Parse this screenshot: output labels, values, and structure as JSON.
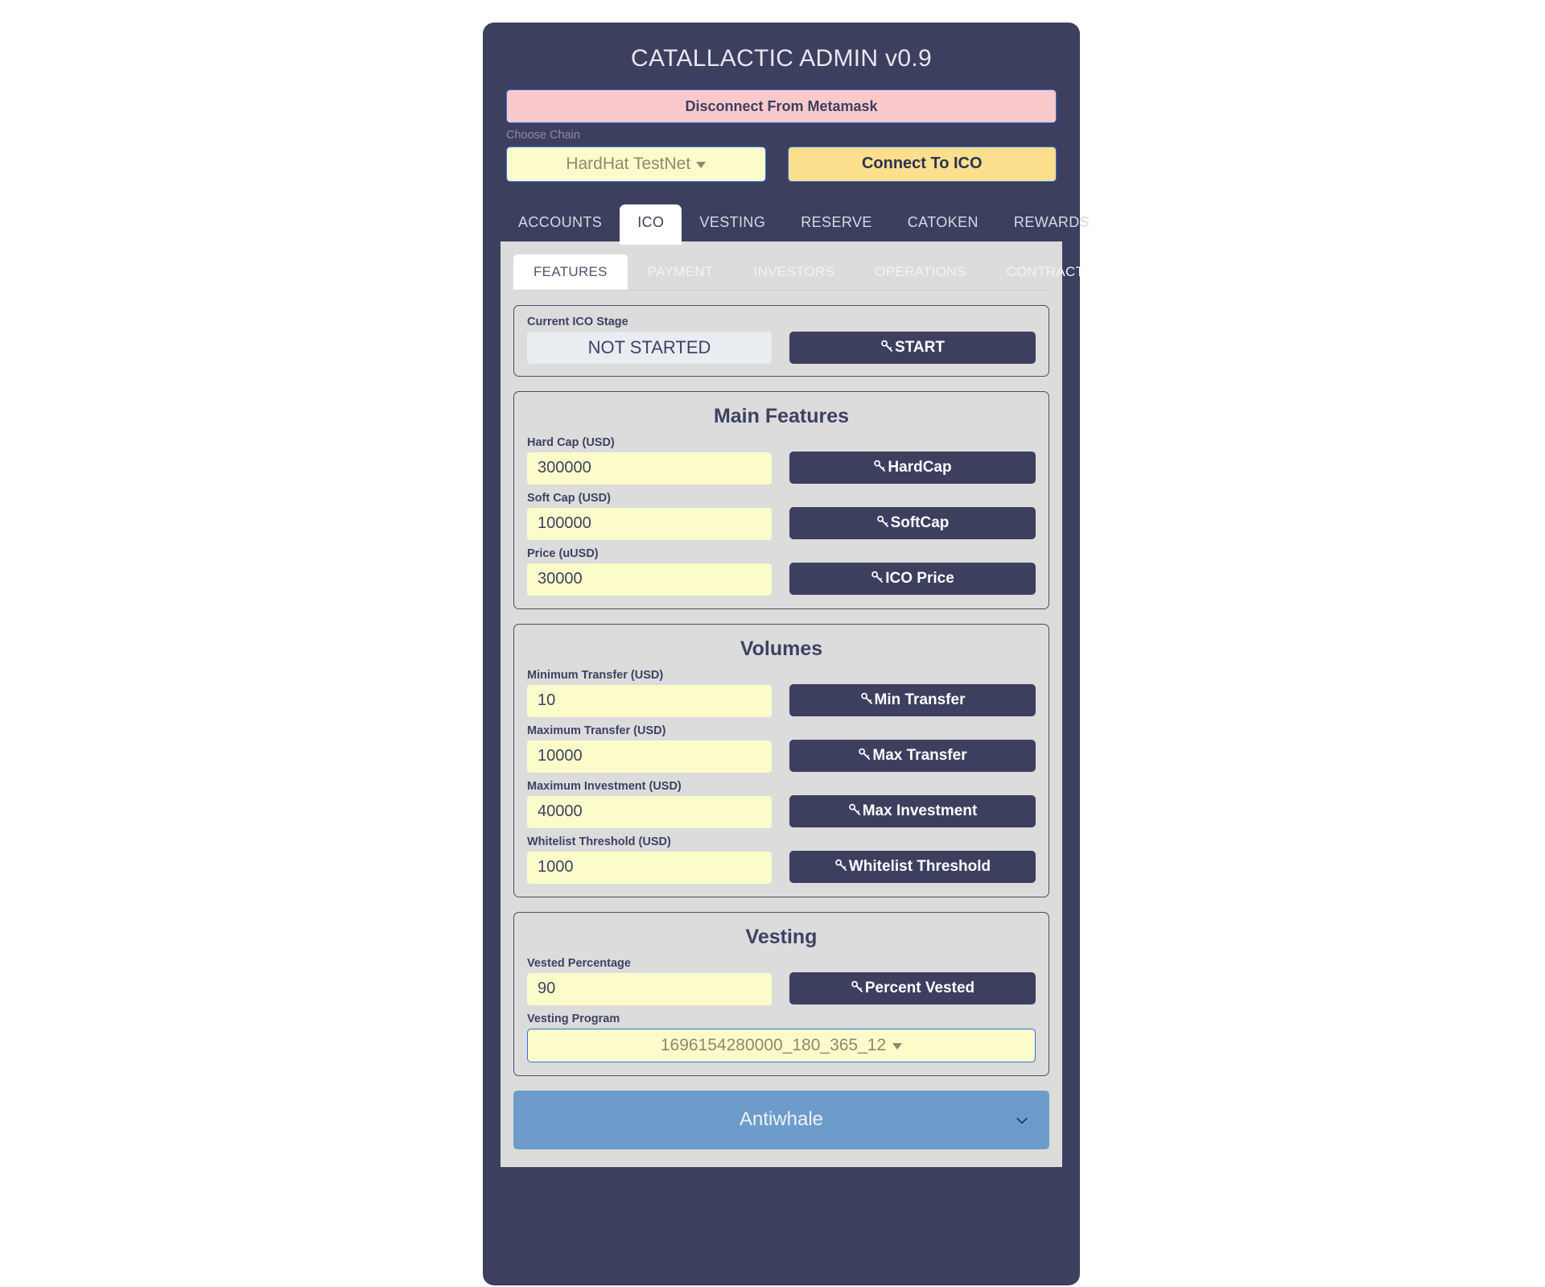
{
  "app": {
    "title": "CATALLACTIC ADMIN v0.9",
    "disconnect_label": "Disconnect From Metamask",
    "chain_label": "Choose Chain",
    "chain_value": "HardHat TestNet",
    "connect_label": "Connect To ICO"
  },
  "main_tabs": [
    {
      "label": "ACCOUNTS",
      "active": false
    },
    {
      "label": "ICO",
      "active": true
    },
    {
      "label": "VESTING",
      "active": false
    },
    {
      "label": "RESERVE",
      "active": false
    },
    {
      "label": "CATOKEN",
      "active": false
    },
    {
      "label": "REWARDS",
      "active": false
    }
  ],
  "sub_tabs": [
    {
      "label": "FEATURES",
      "active": true
    },
    {
      "label": "PAYMENT",
      "active": false
    },
    {
      "label": "INVESTORS",
      "active": false
    },
    {
      "label": "OPERATIONS",
      "active": false
    },
    {
      "label": "CONTRACT",
      "active": false
    }
  ],
  "stage": {
    "label": "Current ICO Stage",
    "value": "NOT STARTED",
    "button_label": "START"
  },
  "main_features": {
    "title": "Main Features",
    "fields": [
      {
        "label": "Hard Cap (USD)",
        "value": "300000",
        "button_label": "HardCap"
      },
      {
        "label": "Soft Cap (USD)",
        "value": "100000",
        "button_label": "SoftCap"
      },
      {
        "label": "Price (uUSD)",
        "value": "30000",
        "button_label": "ICO Price"
      }
    ]
  },
  "volumes": {
    "title": "Volumes",
    "fields": [
      {
        "label": "Minimum Transfer (USD)",
        "value": "10",
        "button_label": "Min Transfer"
      },
      {
        "label": "Maximum Transfer (USD)",
        "value": "10000",
        "button_label": "Max Transfer"
      },
      {
        "label": "Maximum Investment (USD)",
        "value": "40000",
        "button_label": "Max Investment"
      },
      {
        "label": "Whitelist Threshold (USD)",
        "value": "1000",
        "button_label": "Whitelist Threshold"
      }
    ]
  },
  "vesting": {
    "title": "Vesting",
    "percent_label": "Vested Percentage",
    "percent_value": "90",
    "percent_button_label": "Percent Vested",
    "program_label": "Vesting Program",
    "program_value": "1696154280000_180_365_12"
  },
  "antiwhale": {
    "label": "Antiwhale"
  },
  "icons": {
    "key": "key-icon",
    "caret_down": "caret-down-icon",
    "chevron_down": "chevron-down-icon"
  },
  "colors": {
    "card_bg": "#3d3f5f",
    "panel_bg": "#dcdcdc",
    "input_yellow": "#fcfccb",
    "connect_yellow": "#fbdf8d",
    "disconnect_pink": "#f9c9cb",
    "accordion_blue": "#6d9ccb",
    "accent_border": "#2f6fe0"
  }
}
